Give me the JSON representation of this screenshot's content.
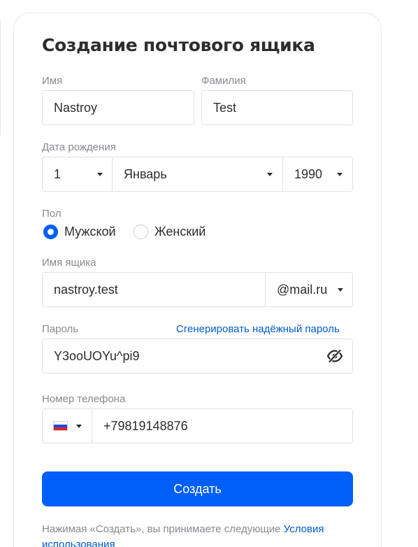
{
  "form": {
    "title": "Создание почтового ящика",
    "first_name": {
      "label": "Имя",
      "value": "Nastroy"
    },
    "last_name": {
      "label": "Фамилия",
      "value": "Test"
    },
    "birth_date": {
      "label": "Дата рождения",
      "day": "1",
      "month": "Январь",
      "year": "1990"
    },
    "gender": {
      "label": "Пол",
      "options": [
        "Мужской",
        "Женский"
      ],
      "selected": "Мужской"
    },
    "mailbox": {
      "label": "Имя ящика",
      "value": "nastroy.test",
      "domain": "@mail.ru"
    },
    "password": {
      "label": "Пароль",
      "generate_link": "Сгенерировать надёжный пароль",
      "value": "Y3ooUOYu^pi9"
    },
    "phone": {
      "label": "Номер телефона",
      "value": "+79819148876"
    },
    "submit_label": "Создать",
    "terms_text": "Нажимая «Создать», вы принимаете следующие ",
    "terms_link": "Условия использования"
  },
  "colors": {
    "accent": "#005ff9",
    "link": "#005bd1",
    "label": "#87898f",
    "border": "#dfe1e5"
  },
  "icons": {
    "password_toggle": "eye-slash-icon",
    "country_flag": "russia-flag-icon"
  }
}
